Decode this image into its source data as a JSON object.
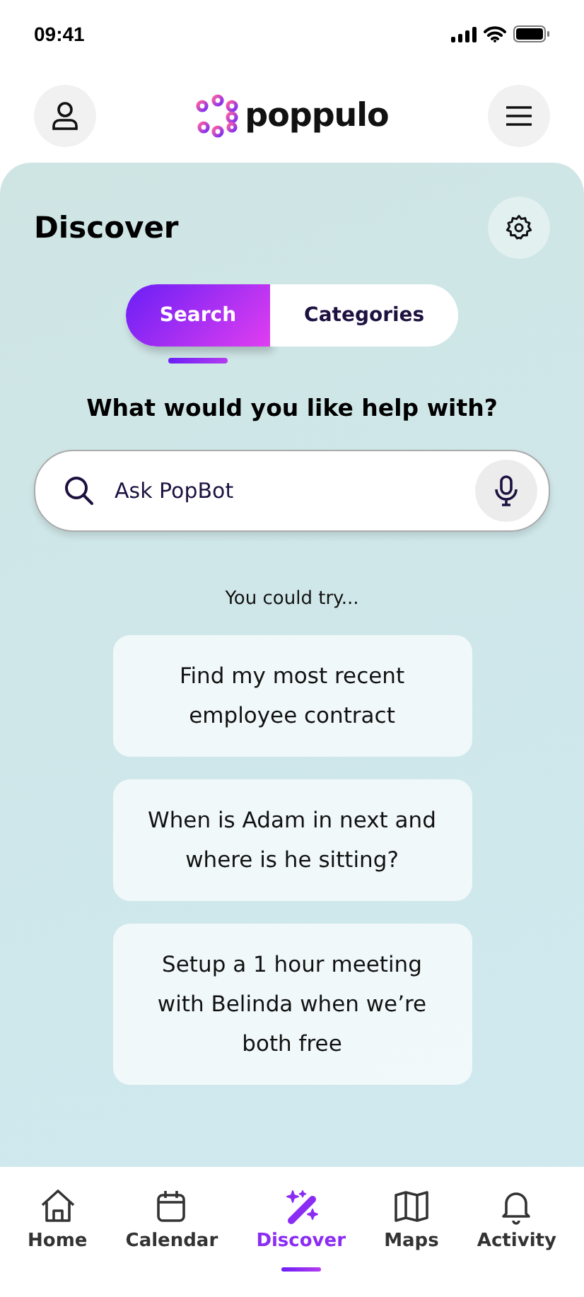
{
  "status_bar": {
    "time": "09:41"
  },
  "header": {
    "logo": "poppulo"
  },
  "panel": {
    "title": "Discover"
  },
  "tabs": [
    {
      "label": "Search",
      "selected": true
    },
    {
      "label": "Categories",
      "selected": false
    }
  ],
  "prompt": "What would you like help with?",
  "search": {
    "placeholder": "Ask PopBot"
  },
  "suggestions_label": "You could try...",
  "suggestions": [
    "Find my most recent employee contract",
    "When is Adam in next and where is he sitting?",
    "Setup a 1 hour meeting with Belinda when we’re both free"
  ],
  "nav": [
    {
      "label": "Home",
      "kind": "home",
      "selected": false
    },
    {
      "label": "Calendar",
      "kind": "calendar",
      "selected": false
    },
    {
      "label": "Discover",
      "kind": "wand",
      "selected": true
    },
    {
      "label": "Maps",
      "kind": "map",
      "selected": false
    },
    {
      "label": "Activity",
      "kind": "bell",
      "selected": false
    }
  ]
}
